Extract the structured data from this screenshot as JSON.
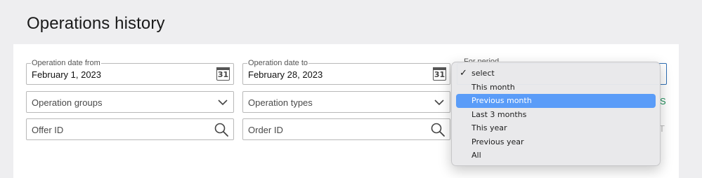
{
  "page": {
    "title": "Operations history"
  },
  "filters": {
    "date_from": {
      "label": "Operation date from",
      "value": "February 1, 2023",
      "calendar_day": "31"
    },
    "date_to": {
      "label": "Operation date to",
      "value": "February 28, 2023",
      "calendar_day": "31"
    },
    "operation_groups": {
      "placeholder": "Operation groups"
    },
    "operation_types": {
      "placeholder": "Operation types"
    },
    "offer_id": {
      "placeholder": "Offer ID"
    },
    "order_id": {
      "placeholder": "Order ID"
    },
    "period": {
      "label": "For period",
      "selected": "select",
      "highlighted": "Previous month",
      "options": [
        "select",
        "This month",
        "Previous month",
        "Last 3 months",
        "This year",
        "Previous year",
        "All"
      ]
    }
  },
  "edge_text": {
    "green": "S",
    "gray": "T"
  },
  "colors": {
    "accent": "#5a9cf8",
    "focus_border": "#2f6fb3",
    "link_green": "#1f8f5a"
  }
}
